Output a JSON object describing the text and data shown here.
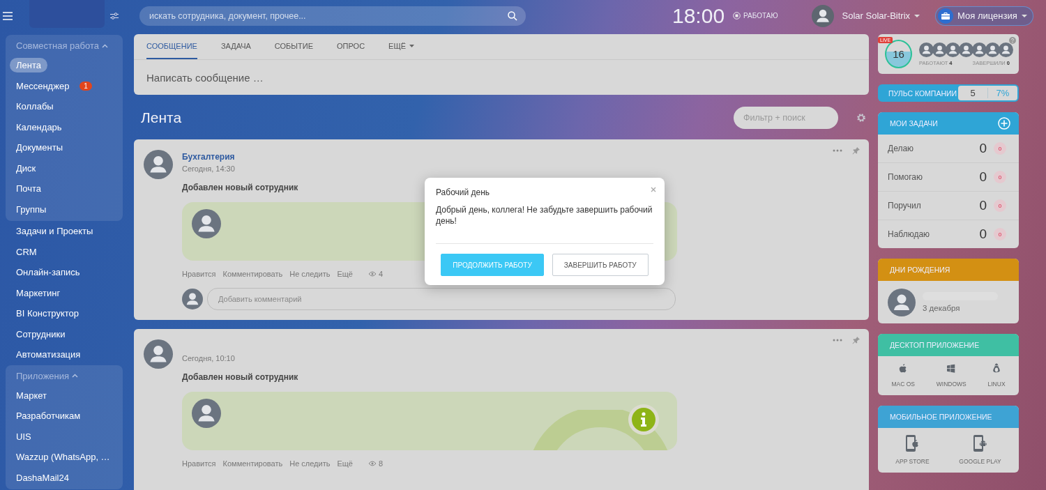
{
  "header": {
    "search": {
      "placeholder": "искать сотрудника, документ, прочее..."
    },
    "clock": "18:00",
    "work_status": "РАБОТАЮ",
    "user": "Solar Solar-Bitrix",
    "license_button": "Моя лицензия"
  },
  "sidebar": {
    "sections": [
      {
        "kind": "group",
        "title": "Совместная работа",
        "expanded": true,
        "items": [
          {
            "label": "Лента",
            "selected": true
          },
          {
            "label": "Мессенджер",
            "selected": false,
            "badge": "1"
          },
          {
            "label": "Коллабы",
            "selected": false
          },
          {
            "label": "Календарь",
            "selected": false
          },
          {
            "label": "Документы",
            "selected": false
          },
          {
            "label": "Диск",
            "selected": false
          },
          {
            "label": "Почта",
            "selected": false
          },
          {
            "label": "Группы",
            "selected": false
          }
        ]
      },
      {
        "kind": "plain",
        "items": [
          {
            "label": "Задачи и Проекты",
            "selected": false
          },
          {
            "label": "CRM",
            "selected": false
          },
          {
            "label": "Онлайн-запись",
            "selected": false
          },
          {
            "label": "Маркетинг",
            "selected": false
          },
          {
            "label": "BI Конструктор",
            "selected": false
          },
          {
            "label": "Сотрудники",
            "selected": false
          },
          {
            "label": "Автоматизация",
            "selected": false
          }
        ]
      },
      {
        "kind": "group",
        "title": "Приложения",
        "expanded": true,
        "items": [
          {
            "label": "Маркет",
            "selected": false
          },
          {
            "label": "Разработчикам",
            "selected": false
          },
          {
            "label": "UIS",
            "selected": false
          },
          {
            "label": "Wazzup (WhatsApp, …",
            "selected": false
          },
          {
            "label": "DashaMail24",
            "selected": false
          }
        ]
      }
    ]
  },
  "composer": {
    "tabs": [
      {
        "label": "СООБЩЕНИЕ",
        "selected": true,
        "dropdown": false
      },
      {
        "label": "ЗАДАЧА",
        "selected": false,
        "dropdown": false
      },
      {
        "label": "СОБЫТИЕ",
        "selected": false,
        "dropdown": false
      },
      {
        "label": "ОПРОС",
        "selected": false,
        "dropdown": false
      },
      {
        "label": "ЕЩЁ",
        "selected": false,
        "dropdown": true
      }
    ],
    "placeholder": "Написать сообщение …"
  },
  "feed": {
    "title": "Лента",
    "filter_placeholder": "Фильтр + поиск",
    "posts": [
      {
        "author": "Бухгалтерия",
        "time": "Сегодня, 14:30",
        "title": "Добавлен новый сотрудник",
        "info_icon": false,
        "actions": [
          "Нравится",
          "Комментировать",
          "Не следить",
          "Ещё"
        ],
        "views": "4",
        "comment_placeholder": "Добавить комментарий"
      },
      {
        "time": "Сегодня, 10:10",
        "title": "Добавлен новый сотрудник",
        "info_icon": true,
        "actions": [
          "Нравится",
          "Комментировать",
          "Не следить",
          "Ещё"
        ],
        "views": "8"
      }
    ]
  },
  "dialog": {
    "title": "Рабочий день",
    "message": "Добрый день, коллега! Не забудьте завершить рабочий день!",
    "buttons": [
      {
        "label": "ПРОДОЛЖИТЬ РАБОТУ",
        "kind": "primary"
      },
      {
        "label": "ЗАВЕРШИТЬ РАБОТУ",
        "kind": "secondary"
      }
    ]
  },
  "pulse_widget": {
    "live": "LIVE",
    "count": "16",
    "working_label": "РАБОТАЮТ",
    "working": "4",
    "finished_label": "ЗАВЕРШИЛИ",
    "finished": "0"
  },
  "company_pulse": {
    "label": "ПУЛЬС КОМПАНИИ",
    "value": "5",
    "percent": "7%"
  },
  "my_tasks": {
    "title": "МОИ ЗАДАЧИ",
    "rows": [
      {
        "label": "Делаю",
        "count": "0",
        "badge": "0"
      },
      {
        "label": "Помогаю",
        "count": "0",
        "badge": "0"
      },
      {
        "label": "Поручил",
        "count": "0",
        "badge": "0"
      },
      {
        "label": "Наблюдаю",
        "count": "0",
        "badge": "0"
      }
    ]
  },
  "birthdays": {
    "title": "ДНИ РОЖДЕНИЯ",
    "date": "3 декабря"
  },
  "desktop_app": {
    "title": "ДЕСКТОП ПРИЛОЖЕНИЕ",
    "items": [
      {
        "label": "MAC OS",
        "kind": "apple"
      },
      {
        "label": "WINDOWS",
        "kind": "windows"
      },
      {
        "label": "LINUX",
        "kind": "linux"
      }
    ]
  },
  "mobile_app": {
    "title": "МОБИЛЬНОЕ ПРИЛОЖЕНИЕ",
    "items": [
      {
        "label": "APP STORE",
        "kind": "apple"
      },
      {
        "label": "GOOGLE PLAY",
        "kind": "android"
      }
    ]
  }
}
